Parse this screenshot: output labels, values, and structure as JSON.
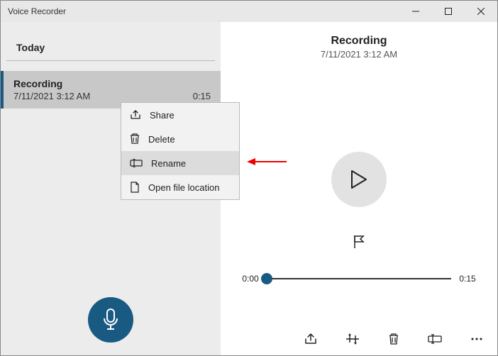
{
  "titlebar": {
    "title": "Voice Recorder"
  },
  "left": {
    "section": "Today",
    "item": {
      "name": "Recording",
      "timestamp": "7/11/2021 3:12 AM",
      "duration": "0:15"
    }
  },
  "context_menu": {
    "share": "Share",
    "delete": "Delete",
    "rename": "Rename",
    "open_loc": "Open file location"
  },
  "right": {
    "title": "Recording",
    "timestamp": "7/11/2021 3:12 AM",
    "time_start": "0:00",
    "time_end": "0:15"
  }
}
